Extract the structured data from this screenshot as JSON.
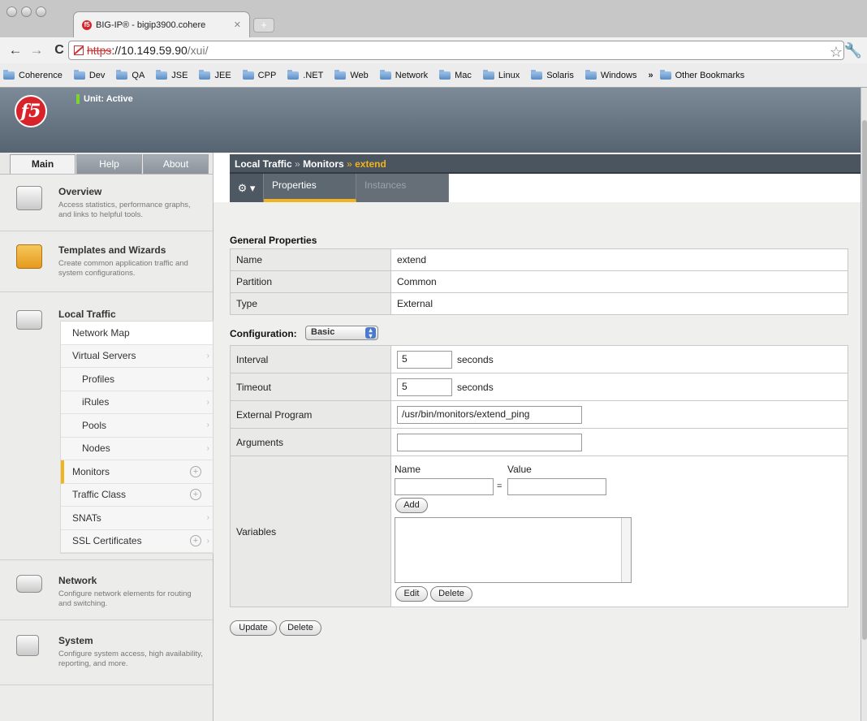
{
  "browser": {
    "tab_title": "BIG-IP® - bigip3900.cohere",
    "tab_close": "✕",
    "url_proto": "https",
    "url_host": "://10.149.59.90",
    "url_path": "/xui/",
    "bookmarks": [
      "Coherence",
      "Dev",
      "QA",
      "JSE",
      "JEE",
      "CPP",
      ".NET",
      "Web",
      "Network",
      "Mac",
      "Linux",
      "Solaris",
      "Windows"
    ],
    "bookmarks_more": "»",
    "other_bookmarks": "Other Bookmarks"
  },
  "header": {
    "logo_text": "f5",
    "unit_status": "Unit: Active"
  },
  "left": {
    "tabs": [
      "Main",
      "Help",
      "About"
    ],
    "overview": {
      "title": "Overview",
      "desc": "Access statistics, performance graphs, and links to helpful tools."
    },
    "templates": {
      "title": "Templates and Wizards",
      "desc": "Create common application traffic and system configurations."
    },
    "local_traffic": {
      "title": "Local Traffic"
    },
    "subnav": [
      "Network Map",
      "Virtual Servers",
      "Profiles",
      "iRules",
      "Pools",
      "Nodes",
      "Monitors",
      "Traffic Class",
      "SNATs",
      "SSL Certificates"
    ],
    "network": {
      "title": "Network",
      "desc": "Configure network elements for routing and switching."
    },
    "system": {
      "title": "System",
      "desc": "Configure system access, high availability, reporting, and more."
    }
  },
  "breadcrumb": {
    "part1": "Local Traffic",
    "sep": "»",
    "part2": "Monitors",
    "part3": "extend"
  },
  "subtabs": {
    "gear": "⚙ ▾",
    "properties": "Properties",
    "instances": "Instances"
  },
  "general": {
    "heading": "General Properties",
    "rows": [
      {
        "label": "Name",
        "value": "extend"
      },
      {
        "label": "Partition",
        "value": "Common"
      },
      {
        "label": "Type",
        "value": "External"
      }
    ]
  },
  "config": {
    "heading": "Configuration:",
    "mode": "Basic",
    "interval_label": "Interval",
    "interval_value": "5",
    "interval_unit": "seconds",
    "timeout_label": "Timeout",
    "timeout_value": "5",
    "timeout_unit": "seconds",
    "program_label": "External Program",
    "program_value": "/usr/bin/monitors/extend_ping",
    "arguments_label": "Arguments",
    "arguments_value": "",
    "variables_label": "Variables",
    "var_name_label": "Name",
    "var_value_label": "Value",
    "var_eq": "=",
    "add_button": "Add",
    "edit_button": "Edit",
    "delete_button": "Delete"
  },
  "actions": {
    "update": "Update",
    "delete": "Delete"
  }
}
